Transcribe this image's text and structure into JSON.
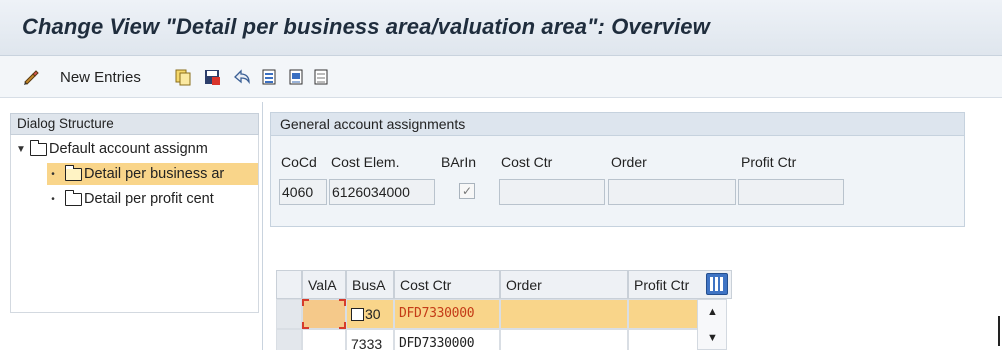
{
  "window": {
    "title": "Change View \"Detail per business area/valuation area\": Overview"
  },
  "toolbar": {
    "new_entries_label": "New Entries",
    "icons": [
      "edit-pencil-icon",
      "copy-icon",
      "save-icon",
      "undo-icon",
      "select-all-icon",
      "select-block-icon",
      "deselect-all-icon"
    ]
  },
  "dialog_structure": {
    "header": "Dialog Structure",
    "items": [
      {
        "label": "Default account assignm",
        "level": 0,
        "expanded": true,
        "selected": false
      },
      {
        "label": "Detail per business ar",
        "level": 1,
        "selected": true
      },
      {
        "label": "Detail per profit cent",
        "level": 1,
        "selected": false
      }
    ]
  },
  "general": {
    "header": "General account assignments",
    "labels": {
      "coCd": "CoCd",
      "costElem": "Cost Elem.",
      "barIn": "BArIn",
      "costCtr": "Cost Ctr",
      "order": "Order",
      "profitCtr": "Profit Ctr"
    },
    "values": {
      "coCd": "4060",
      "costElem": "6126034000",
      "barIn_checked": true,
      "costCtr": "",
      "order": "",
      "profitCtr": ""
    }
  },
  "table": {
    "headers": {
      "valA": "ValA",
      "busA": "BusA",
      "costCtr": "Cost Ctr",
      "order": "Order",
      "profitCtr": "Profit Ctr"
    },
    "rows": [
      {
        "valA": "",
        "busA": "30",
        "costCtr": "DFD7330000",
        "order": "",
        "profitCtr": "",
        "selected": true
      },
      {
        "valA": "",
        "busA": "7333",
        "costCtr": "DFD7330000",
        "order": "",
        "profitCtr": "",
        "selected": false
      }
    ]
  },
  "colors": {
    "selection": "#f9d58a",
    "title_bg": "#dfe6ee",
    "value_red": "#c43b17"
  }
}
